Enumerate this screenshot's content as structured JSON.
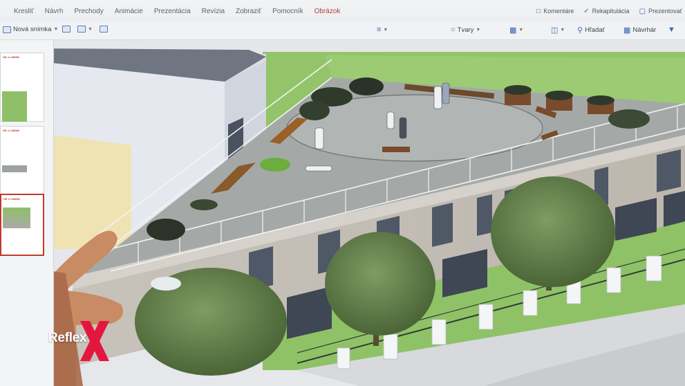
{
  "ribbon": {
    "tabs": [
      "Kresliť",
      "Návrh",
      "Prechody",
      "Animácie",
      "Prezentácia",
      "Revízia",
      "Zobraziť",
      "Pomocník",
      "Obrázok"
    ],
    "active_tab": "Obrázok",
    "right_actions": [
      {
        "label": "Komentáre",
        "icon": "comment-icon"
      },
      {
        "label": "Rekapitulácia",
        "icon": "recap-icon"
      },
      {
        "label": "Prezentovať",
        "icon": "present-icon"
      }
    ]
  },
  "toolbar": {
    "new_slide_label": "Nová snímka",
    "shapes_label": "Tvary",
    "find_label": "Hľadať",
    "designer_label": "Návrhár"
  },
  "thumbnails": [
    {
      "label": "ÚK s LNNNK"
    },
    {
      "label": "ÚK s LNNNK"
    },
    {
      "label": "ÚK s LNNNK"
    }
  ],
  "overlay": {
    "logo_text": "Reflex",
    "logo_color": "#e3173e"
  },
  "colors": {
    "accent_tab": "#b0413e",
    "grass": "#93c86a",
    "deck": "#a6abaa",
    "building": "#c9c4bd"
  }
}
